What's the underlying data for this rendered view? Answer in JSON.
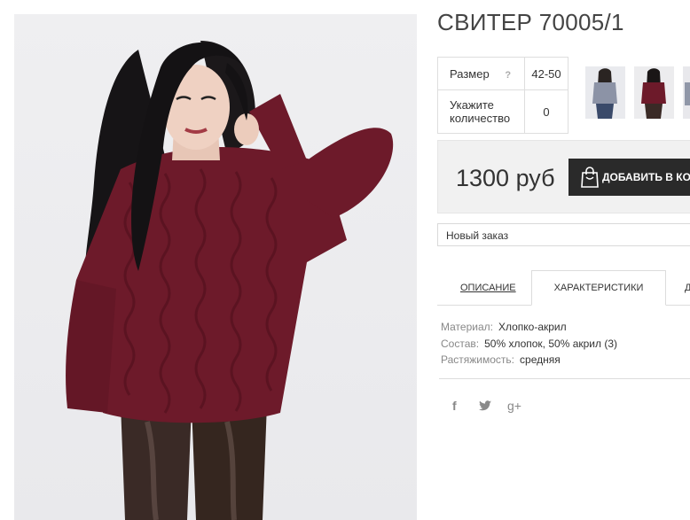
{
  "product": {
    "title": "СВИТЕР 70005/1",
    "size_label": "Размер",
    "size_help": "?",
    "size_value": "42-50",
    "qty_label": "Укажите количество",
    "qty_value": "0",
    "price": "1300 руб",
    "add_button": "ДОБАВИТЬ В КОРЗИНУ",
    "order_select": "Новый заказ"
  },
  "tabs": {
    "description": "ОПИСАНИЕ",
    "characteristics": "ХАРАКТЕРИСТИКИ",
    "more": "Д"
  },
  "characteristics": [
    {
      "key": "Материал:",
      "value": "Хлопко-акрил"
    },
    {
      "key": "Состав:",
      "value": "50% хлопок, 50% акрил (3)"
    },
    {
      "key": "Растяжимость:",
      "value": "средняя"
    }
  ],
  "social": {
    "facebook": "f",
    "twitter": "twitter-icon",
    "google": "g+"
  },
  "colors": {
    "sweater": "#6d1a2a",
    "button": "#2a2a2a",
    "pricebox": "#f1f1f1"
  }
}
